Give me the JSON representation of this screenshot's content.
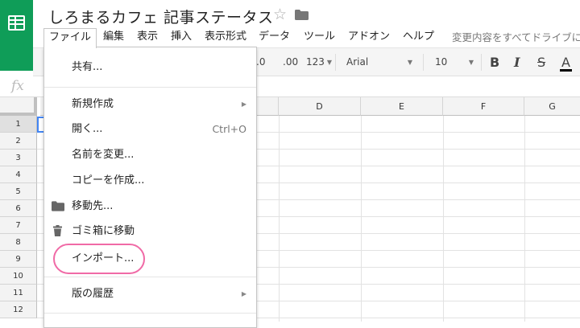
{
  "app": {
    "logo_icon": "google-sheets-icon",
    "accent_color": "#0f9d58"
  },
  "document": {
    "title": "しろまるカフェ 記事ステータス",
    "star_icon": "☆",
    "folder_icon": "folder-icon"
  },
  "menubar": {
    "items": [
      {
        "label": "ファイル"
      },
      {
        "label": "編集"
      },
      {
        "label": "表示"
      },
      {
        "label": "挿入"
      },
      {
        "label": "表示形式"
      },
      {
        "label": "データ"
      },
      {
        "label": "ツール"
      },
      {
        "label": "アドオン"
      },
      {
        "label": "ヘルプ"
      }
    ],
    "save_status": "変更内容をすべてドライブに"
  },
  "toolbar": {
    "decimal_decrease": ".0",
    "decimal_increase": ".00",
    "number_format": "123",
    "font": "Arial",
    "font_size": "10",
    "bold": "B",
    "italic": "I",
    "strikethrough": "S",
    "text_color": "A"
  },
  "formula_bar": {
    "fx": "fx"
  },
  "grid": {
    "columns": [
      "D",
      "E",
      "F",
      "G"
    ],
    "rows": [
      "1",
      "2",
      "3",
      "4",
      "5",
      "6",
      "7",
      "8",
      "9",
      "10",
      "11",
      "12"
    ]
  },
  "file_menu": {
    "items": [
      {
        "label": "共有..."
      },
      {
        "label": "新規作成",
        "submenu": "▶"
      },
      {
        "label": "開く...",
        "shortcut": "Ctrl+O"
      },
      {
        "label": "名前を変更..."
      },
      {
        "label": "コピーを作成..."
      },
      {
        "label": "移動先...",
        "icon": "folder-icon"
      },
      {
        "label": "ゴミ箱に移動",
        "icon": "trash-icon"
      },
      {
        "label": "インポート..."
      },
      {
        "label": "版の履歴",
        "submenu": "▶"
      }
    ]
  },
  "annotation": {
    "ring_color": "#f06aa6"
  }
}
